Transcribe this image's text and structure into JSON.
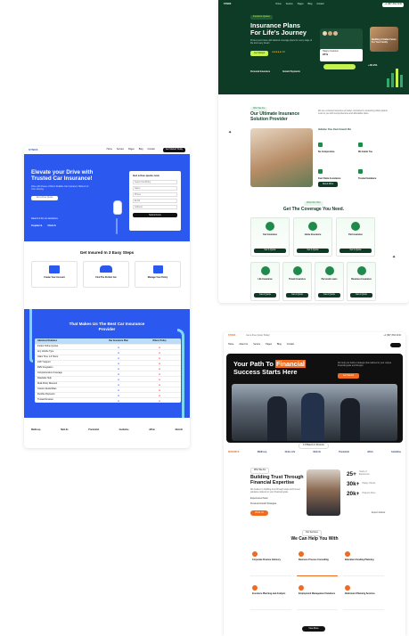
{
  "left": {
    "brand": "SYNOX",
    "nav": [
      "Home",
      "Service",
      "Pages",
      "Blog",
      "Contact"
    ],
    "cta": "Get Started Today",
    "hero_title": "Elevate your Drive with Trusted Car Insurance!",
    "hero_sub": "Drive with Peace of Mind: Reliable Car Insurance Tailored for Your Journey",
    "hero_btn": "Get a Free Quote",
    "rating": "Rated 4.9 for our assistance",
    "partners_top": [
      "Capterra",
      "Clutch"
    ],
    "quote_title": "Get a free quote now",
    "quote_fields": [
      "Select Car/Policy",
      "Name",
      "Phone",
      "Email",
      "Address"
    ],
    "quote_btn": "Submit Form",
    "steps_title": "Get Insured In 3 Easy Steps",
    "steps": [
      "Create Your Account",
      "Find The Perfect Car",
      "Manage Your Policy"
    ],
    "compare_title": "That Makes Us The Best Car Insurance Provider",
    "compare_cols": [
      "Advanced Features",
      "Our Insurance Plan",
      "Others Policy"
    ],
    "compare_rows": [
      "Instant Online Quotes",
      "Any Vehicle Type",
      "Claim Time 1-3 Hours",
      "24X7 Support",
      "DMV Integration",
      "Comprehensive Coverage",
      "Roadside Help",
      "Multi-Policy Discount",
      "Custom Deductibles",
      "Flexible Payments",
      "Trusted Reviews"
    ],
    "logos": [
      "Mailhoop",
      "MetLife",
      "Prudential",
      "Guideline",
      "affirm",
      "MetLife"
    ]
  },
  "top_right": {
    "brand": "SYNOX",
    "nav": [
      "Home",
      "Service",
      "Pages",
      "Blog",
      "Contact"
    ],
    "phone": "+1 (987) 654 3210",
    "badge": "Insurance Quotes",
    "hero_title": "Insurance Plans For Life's Journey",
    "hero_sub": "Protect your future with tailored coverage plans for every stage of life and every dream.",
    "hero_btn": "Get Started",
    "stars": "★★★★★ 4.9",
    "card_label": "Happy Customer",
    "card_value": "97%",
    "percent": "+40.2%",
    "features": [
      "Personal Insurance",
      "Instant Payments"
    ],
    "side_card": "Building A Stable Future For Your Family",
    "about_tag": "Who We Are",
    "about_title": "Our Ultimate Insurance Solution Provider",
    "about_text": "We are a trusted insurance provider committed to protecting what matters most to you with comprehensive and affordable plans.",
    "about_points_title": "Advice You Can Count On",
    "about_points": [
      "No Compromise",
      "We Guide You",
      "Fast Claim Assistance",
      "Trusted Guidance"
    ],
    "about_btn": "About More",
    "coverage_tag": "What We Offer",
    "coverage_title": "Get The Coverage You Need.",
    "coverage_top": [
      "Car Insurance",
      "Home Insurance",
      "Pet Insurance"
    ],
    "coverage_bottom": [
      "Life Insurance",
      "Travel Insurance",
      "Personal Loans",
      "Business Insurance"
    ],
    "coverage_btn": "Get A Quote"
  },
  "bottom_right": {
    "brand": "SYNOX",
    "topbar_text": "Get a Free Quote Today!",
    "phone": "+1 (987) 654 3210",
    "nav": [
      "Home",
      "About Us",
      "Service",
      "Pages",
      "Blog",
      "Contact"
    ],
    "hero_title_a": "Your Path To ",
    "hero_title_b": "Financial",
    "hero_title_c": "Success Starts Here",
    "hero_sub": "We help you build a strategic plan tailored to your unique financial goals and lifestyle.",
    "hero_btn": "Get Started",
    "rating": "4.9 Based on Reviews",
    "logos": [
      "MAVERICK",
      "Mailhoop",
      "Globe Life",
      "MetLife",
      "Prudential",
      "affirm",
      "Guideline"
    ],
    "about_tag": "Who We Are",
    "about_title": "Building Trust Through Financial Expertise",
    "about_text": "We believe in building trust through clear and honest guidance tailored to your financial goals.",
    "about_points": [
      "Experienced Team",
      "Personal Growth Strategies"
    ],
    "about_btn": "About Us",
    "stats": [
      {
        "value": "25+",
        "label": "Years of Experience"
      },
      {
        "value": "30k+",
        "label": "Happy Clients"
      },
      {
        "value": "20k+",
        "label": "Projects Done"
      }
    ],
    "expert": "Expert Advisor",
    "help_tag": "Our Services",
    "help_title": "We Can Help You With",
    "services": [
      "Corporate Finance Advisory",
      "Business Process Consulting",
      "Education Funding Planning",
      "Insurance Planning and Analysis",
      "Employment Management Solutions",
      "Retirement Planning Services"
    ],
    "view_btn": "View More"
  },
  "colors": {
    "blue": "#2b58ee",
    "green_dark": "#0e3b26",
    "green": "#1f8a4c",
    "lime": "#c6f24e",
    "orange": "#ef6b1f"
  }
}
